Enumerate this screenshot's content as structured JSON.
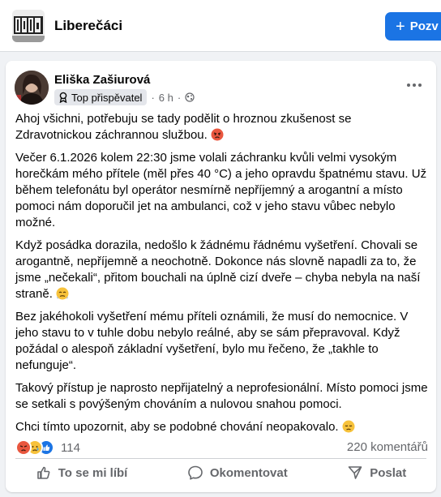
{
  "header": {
    "group_name": "Liberečáci",
    "invite_label": "Pozv",
    "brand_color": "#1b74e4"
  },
  "post": {
    "author": "Eliška Zašiurová",
    "badge": "Top přispěvatel",
    "time": "6 h",
    "separator": "·",
    "paragraphs": [
      "Ahoj všichni, potřebuju se tady podělit o hroznou zkušenost se Zdravotnickou záchrannou službou.",
      "Večer 6.1.2026 kolem 22:30 jsme volali záchranku kvůli velmi vysokým horečkám mého přítele (měl přes 40 °C) a jeho opravdu špatnému stavu. Už během telefonátu byl operátor nesmírně nepříjemný a arogantní a místo pomoci nám doporučil jet na ambulanci, což v jeho stavu vůbec nebylo možné.",
      "Když posádka dorazila, nedošlo k žádnému řádnému vyšetření. Chovali se arogantně, nepříjemně a neochotně. Dokonce nás slovně napadli za to, že jsme „nečekali“, přitom bouchali na úplně cizí dveře – chyba nebyla na naší straně.",
      "Bez jakéhokoli vyšetření mému příteli oznámili, že musí do nemocnice. V jeho stavu to v tuhle dobu nebylo reálné, aby se sám přepravoval. Když požádal o alespoň základní vyšetření, bylo mu řečeno, že „takhle to nefunguje“.",
      "Takový přístup je naprosto nepřijatelný a neprofesionální. Místo pomoci jsme se setkali s povýšeným chováním a nulovou snahou pomoci.",
      "Chci tímto upozornit, aby se podobné chování neopakovalo."
    ],
    "reaction_count": "114",
    "comments_count": "220 komentářů",
    "reaction_icons": [
      "angry-reaction-icon",
      "sad-reaction-icon",
      "like-reaction-icon"
    ]
  },
  "actions": {
    "like": "To se mi líbí",
    "comment": "Okomentovat",
    "share": "Poslat"
  }
}
